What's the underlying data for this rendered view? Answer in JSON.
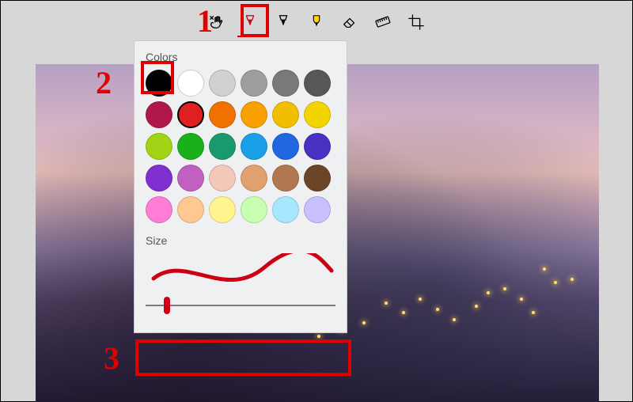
{
  "toolbar": {
    "tools": [
      {
        "name": "touch-writing",
        "icon": "hand-pen-icon",
        "active": false
      },
      {
        "name": "ballpoint-pen",
        "icon": "pen-icon",
        "active": true
      },
      {
        "name": "pencil",
        "icon": "pencil-icon",
        "active": false
      },
      {
        "name": "highlighter",
        "icon": "highlighter-icon",
        "active": false
      },
      {
        "name": "eraser",
        "icon": "eraser-icon",
        "active": false
      },
      {
        "name": "ruler",
        "icon": "ruler-icon",
        "active": false
      },
      {
        "name": "crop",
        "icon": "crop-icon",
        "active": false
      }
    ]
  },
  "dropdown": {
    "colors_label": "Colors",
    "size_label": "Size",
    "swatches": [
      "#000000",
      "#ffffff",
      "#d0d0d0",
      "#9e9e9e",
      "#797979",
      "#575757",
      "#b0174d",
      "#e02020",
      "#f07000",
      "#f7a000",
      "#f2bf00",
      "#f2d500",
      "#a2d316",
      "#1ab01a",
      "#1a9a6c",
      "#1aa0e6",
      "#1f68e0",
      "#4830c0",
      "#8030d0",
      "#c060c0",
      "#f3c8b8",
      "#e0a070",
      "#b07850",
      "#6b4528",
      "#ff7dd6",
      "#ffc890",
      "#fff490",
      "#c8ffb0",
      "#a8e8ff",
      "#c8c0ff"
    ],
    "selected_index": 7,
    "preview_color": "#cc0012",
    "size_value": 12,
    "size_min": 1,
    "size_max": 100
  },
  "callouts": {
    "1": "1",
    "2": "2",
    "3": "3"
  }
}
